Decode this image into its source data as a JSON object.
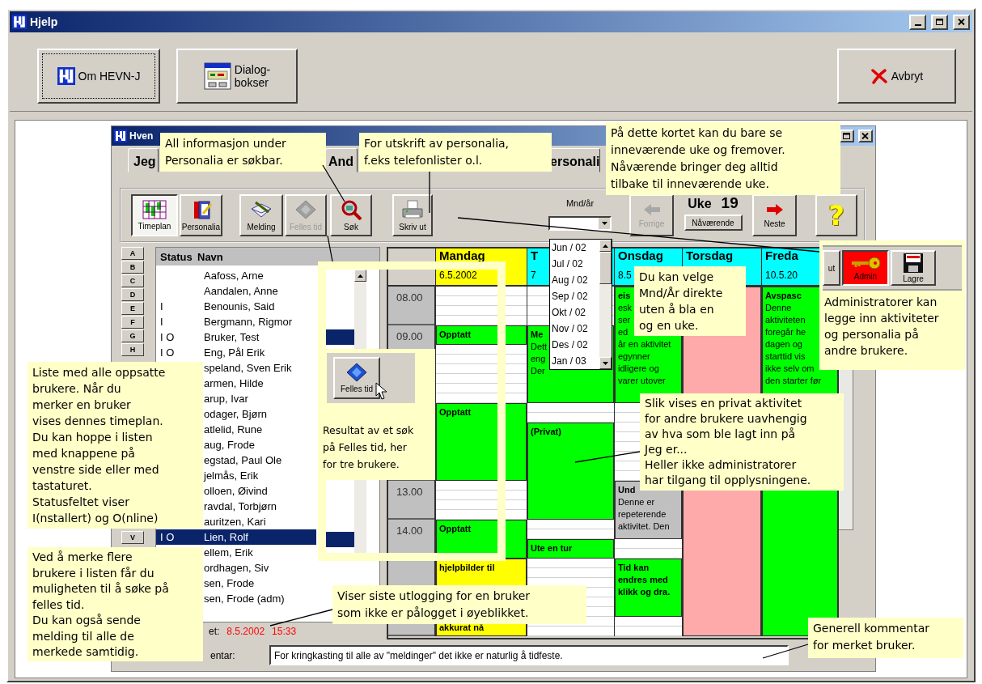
{
  "window": {
    "title": "Hjelp"
  },
  "top_buttons": [
    {
      "kind": "about",
      "label": "Om HEVN-J",
      "focused": true
    },
    {
      "kind": "dialogs",
      "label": "Dialog-\nbokser",
      "focused": false
    },
    {
      "kind": "cancel",
      "label": "Avbryt",
      "focused": false
    }
  ],
  "app": {
    "title": "Hven",
    "tabs": [
      {
        "label": "Jeg"
      },
      {
        "label": "And"
      },
      {
        "label": "ersonali"
      }
    ],
    "toolbar": [
      {
        "kind": "timeplan",
        "label": "Timeplan",
        "pressed": true,
        "disabled": false
      },
      {
        "kind": "personalia",
        "label": "Personalia",
        "pressed": false,
        "disabled": false
      },
      {
        "kind": "melding",
        "label": "Melding",
        "pressed": false,
        "disabled": false
      },
      {
        "kind": "felles",
        "label": "Felles tid",
        "pressed": false,
        "disabled": true
      },
      {
        "kind": "sok",
        "label": "Søk",
        "pressed": false,
        "disabled": false
      },
      {
        "kind": "skriv",
        "label": "Skriv ut",
        "pressed": false,
        "disabled": false
      },
      {
        "kind": "month",
        "label": "Mnd/år"
      },
      {
        "kind": "forrige",
        "label": "Forrige",
        "pressed": false,
        "disabled": true
      },
      {
        "kind": "week",
        "label": "Uke",
        "number": "19",
        "button": "Nåværende"
      },
      {
        "kind": "neste",
        "label": "Neste",
        "pressed": false,
        "disabled": false
      },
      {
        "kind": "help",
        "glyph": "?",
        "pressed": false,
        "disabled": false
      }
    ],
    "month_options": [
      "Jun / 02",
      "Jul / 02",
      "Aug / 02",
      "Sep / 02",
      "Okt / 02",
      "Nov / 02",
      "Des / 02",
      "Jan / 03"
    ],
    "letters": [
      "A",
      "B",
      "C",
      "D",
      "E",
      "F",
      "G",
      "H"
    ],
    "letters_bottom": [
      "V"
    ],
    "list": {
      "columns": [
        "Status",
        "Navn"
      ],
      "rows": [
        {
          "name": "Aafoss, Arne",
          "selected": false
        },
        {
          "name": "Aandalen, Anne",
          "selected": false
        },
        {
          "status": "I",
          "name": "Benounis, Said",
          "selected": false
        },
        {
          "status": "I",
          "name": "Bergmann, Rigmor",
          "selected": false
        },
        {
          "status": "I O",
          "name": "Bruker, Test",
          "selected": false
        },
        {
          "status": "I O",
          "name": "Eng, Pål Erik",
          "selected": false
        },
        {
          "name": "speland, Sven Erik",
          "selected": false
        },
        {
          "name": "armen, Hilde",
          "selected": false
        },
        {
          "name": "arup, Ivar",
          "selected": false
        },
        {
          "name": "odager, Bjørn",
          "selected": false
        },
        {
          "name": "atlelid, Rune",
          "selected": false
        },
        {
          "name": "aug, Frode",
          "selected": false
        },
        {
          "name": "egstad, Paul Ole",
          "selected": false
        },
        {
          "name": "jelmås, Erik",
          "selected": false
        },
        {
          "name": "olloen, Øivind",
          "selected": false
        },
        {
          "name": "ravdal, Torbjørn",
          "selected": false
        },
        {
          "name": "auritzen, Kari",
          "selected": false
        },
        {
          "status": "I O",
          "name": "Lien, Rolf",
          "selected": true
        },
        {
          "name": "ellem, Erik",
          "selected": false
        },
        {
          "name": "ordhagen, Siv",
          "selected": false
        },
        {
          "name": "sen, Frode",
          "selected": false
        },
        {
          "name": "sen, Frode (adm)",
          "selected": false
        }
      ]
    },
    "last_logout": {
      "label": "et:",
      "date": "8.5.2002",
      "time": "15:33"
    },
    "comment": {
      "label": "entar:",
      "value": "For kringkasting til alle av \"meldinger\" det ikke er naturlig å tidfeste."
    },
    "calendar": {
      "times": [
        "08.00",
        "09.00",
        "13.00",
        "14.00"
      ],
      "days": [
        {
          "name": "Mandag",
          "date": "6.5.2002",
          "color": "#ffff00",
          "events": [
            {
              "title": "Opptatt",
              "color": "#00ff00"
            },
            {
              "title": "Opptatt",
              "color": "#00ff00"
            },
            {
              "title": "Opptatt",
              "color": "#00ff00"
            },
            {
              "title": "hjelpbilder til",
              "footer": "akkurat nå",
              "color": "#ffff00"
            }
          ]
        },
        {
          "name": "T",
          "date": "7",
          "color": "#00ffff",
          "events": [
            {
              "title": "Me",
              "body": "Dett\neng\nDer",
              "color": "#00ff00"
            },
            {
              "title": "(Privat)",
              "color": "#00ff00"
            },
            {
              "title": "Ute en tur",
              "color": "#00ff00"
            }
          ]
        },
        {
          "name": "Onsdag",
          "date": "8.5",
          "color": "#00ffff",
          "events": [
            {
              "title": "eis",
              "body": "esk\nser\ned\når en aktivitet\negynner\nidligere og\nvarer utover",
              "color": "#00ff00"
            },
            {
              "title": "Und",
              "body": "Denne er\nrepeterende\naktivitet. Den",
              "color": "#c0c0c0"
            },
            {
              "title": "Tid kan\nendres med\nklikk og dra.",
              "color": "#00ff00"
            }
          ]
        },
        {
          "name": "Torsdag",
          "color": "#00ffff",
          "events": [
            {
              "color": "#ffaaaa"
            }
          ]
        },
        {
          "name": "Freda",
          "date": "10.5.20",
          "color": "#00ffff",
          "events": [
            {
              "title": "Avspasc",
              "body": "Denne\naktiviteten\nforegår he\ndagen og\nstarttid vis\nikke selv om\nden starter før",
              "color": "#00ff00"
            }
          ]
        }
      ]
    }
  },
  "callouts": [
    {
      "kind": "note",
      "text": "All informasjon under\nPersonalia er søkbar."
    },
    {
      "kind": "note",
      "text": "For utskrift av personalia,\nf.eks telefonlister o.l."
    },
    {
      "kind": "note",
      "text": "På dette kortet kan du bare se\ninneværende uke og fremover.\nNåværende bringer deg alltid\ntilbake til inneværende uke."
    },
    {
      "kind": "admin-inset",
      "buttons": [
        {
          "label": "ut",
          "active": false
        },
        {
          "label": "Admin",
          "active": true
        },
        {
          "label": "Lagre",
          "active": false
        }
      ],
      "text": "Administratorer kan\nlegge inn aktiviteter\nog personalia på\nandre brukere."
    },
    {
      "kind": "search-inset",
      "button": "Felles tid",
      "rows_top": [
        {
          "selected": false
        },
        {
          "selected": false
        },
        {
          "selected": false
        },
        {
          "selected": false
        },
        {
          "selected": true
        }
      ],
      "rows_bottom": [
        {
          "selected": false
        },
        {
          "selected": false
        },
        {
          "selected": false
        },
        {
          "selected": false
        },
        {
          "selected": true
        }
      ],
      "text": "Resultat av et søk\npå Felles tid, her\nfor tre brukere."
    },
    {
      "kind": "note",
      "text": "Du kan velge\nMnd/År direkte\nuten å bla en\nog en uke."
    },
    {
      "kind": "note",
      "text": "Liste med alle oppsatte\nbrukere. Når du\nmerker en bruker\nvises dennes timeplan.\nDu kan hoppe i listen\nmed knappene på\nvenstre side eller med\ntastaturet.\nStatusfeltet viser\nI(nstallert) og O(nline)"
    },
    {
      "kind": "note",
      "text": "Slik vises en privat aktivitet\nfor andre brukere uavhengig\nav hva som ble lagt inn på\nJeg er...\nHeller ikke administratorer\nhar tilgang til opplysningene."
    },
    {
      "kind": "note",
      "text": "Ved å merke flere\nbrukere i listen får du\nmuligheten til å søke på\nfelles tid.\nDu kan også sende\nmelding til alle de\nmerkede samtidig."
    },
    {
      "kind": "note",
      "text": "Viser siste utlogging for en bruker\nsom ikke er pålogget i øyeblikket."
    },
    {
      "kind": "note",
      "text": "Generell kommentar\nfor merket bruker."
    }
  ]
}
